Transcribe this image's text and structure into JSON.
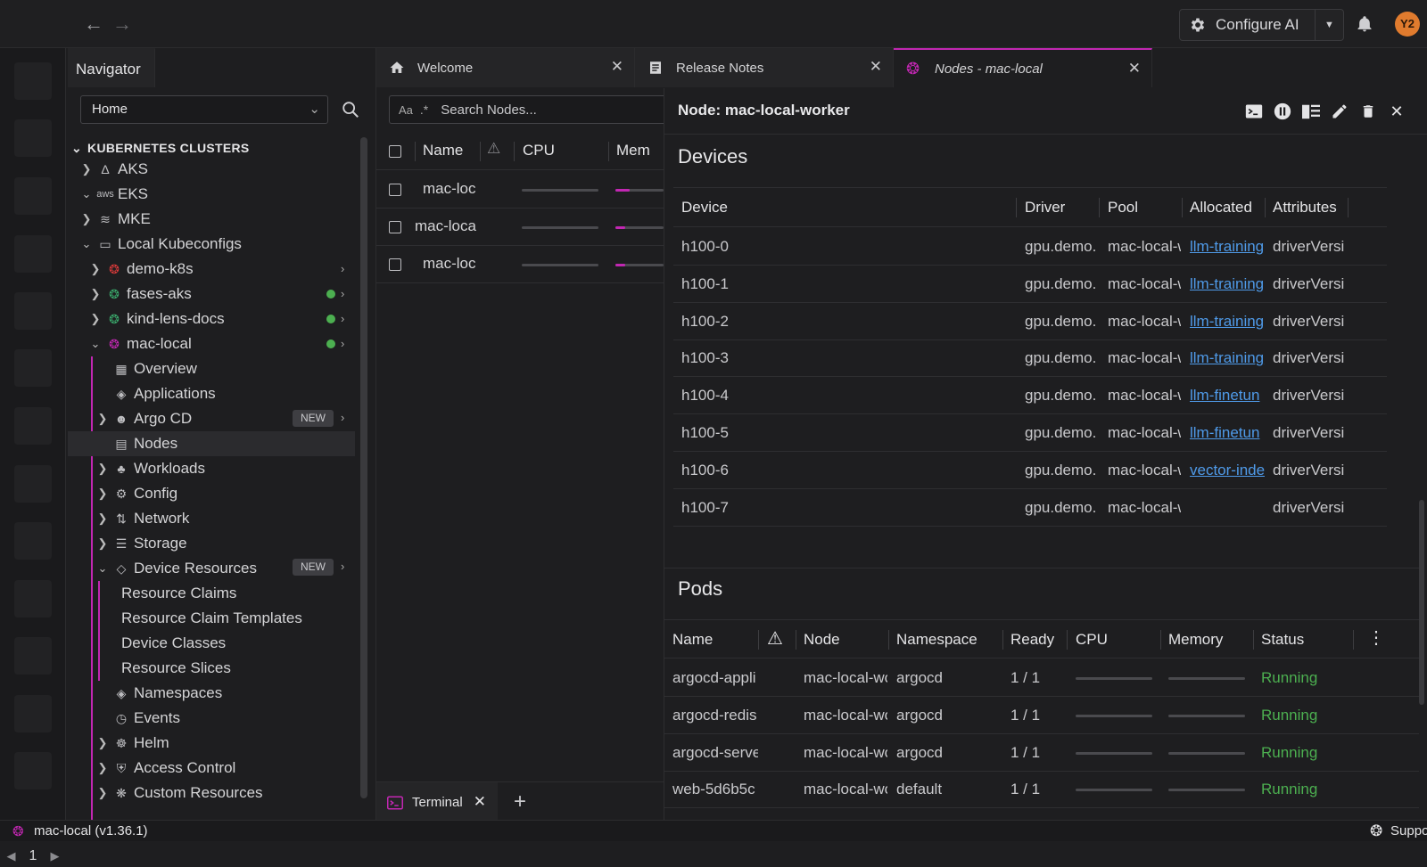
{
  "topbar": {
    "configure_label": "Configure AI",
    "avatar_initials": "Y2"
  },
  "rail": {
    "page": "1"
  },
  "navigator": {
    "tab_label": "Navigator",
    "location": "Home",
    "section_title": "KUBERNETES CLUSTERS",
    "providers": {
      "aks": "AKS",
      "eks": "EKS",
      "eks_logo": "aws",
      "mke": "MKE",
      "local": "Local Kubeconfigs"
    },
    "clusters": {
      "demo": "demo-k8s",
      "fases": "fases-aks",
      "kind": "kind-lens-docs",
      "mac": "mac-local"
    },
    "menu": {
      "overview": "Overview",
      "applications": "Applications",
      "argo": "Argo CD",
      "nodes": "Nodes",
      "workloads": "Workloads",
      "config": "Config",
      "network": "Network",
      "storage": "Storage",
      "device_resources": "Device Resources",
      "resource_claims": "Resource Claims",
      "resource_claim_templates": "Resource Claim Templates",
      "device_classes": "Device Classes",
      "resource_slices": "Resource Slices",
      "namespaces": "Namespaces",
      "events": "Events",
      "helm": "Helm",
      "access_control": "Access Control",
      "custom_resources": "Custom Resources"
    },
    "new_badge": "NEW",
    "colors": {
      "accent": "#c227b2",
      "connected": "#4caf50",
      "demo_icon": "#d83a3a",
      "aks_icon": "#3aa86b"
    }
  },
  "tabs": {
    "welcome": "Welcome",
    "release_notes": "Release Notes",
    "nodes": "Nodes - mac-local"
  },
  "nodes_list": {
    "search_case": "Aa",
    "search_regex": ".*",
    "search_placeholder": "Search Nodes...",
    "columns": {
      "name": "Name",
      "cpu": "CPU",
      "memory": "Mem"
    },
    "rows": [
      {
        "name": "mac-loc",
        "cpu": 0,
        "mem": 0.3
      },
      {
        "name": "mac-loca",
        "cpu": 0,
        "mem": 0.2
      },
      {
        "name": "mac-loc",
        "cpu": 0,
        "mem": 0.2
      }
    ]
  },
  "terminal": {
    "label": "Terminal"
  },
  "details": {
    "title": "Node: mac-local-worker",
    "devices": {
      "heading": "Devices",
      "columns": {
        "device": "Device",
        "driver": "Driver",
        "pool": "Pool",
        "allocated": "Allocated",
        "attributes": "Attributes"
      },
      "rows": [
        {
          "device": "h100-0",
          "driver": "gpu.demo.",
          "pool": "mac-local-w",
          "allocated": "llm-training",
          "attributes": "driverVersi"
        },
        {
          "device": "h100-1",
          "driver": "gpu.demo.",
          "pool": "mac-local-w",
          "allocated": "llm-training",
          "attributes": "driverVersi"
        },
        {
          "device": "h100-2",
          "driver": "gpu.demo.",
          "pool": "mac-local-w",
          "allocated": "llm-training",
          "attributes": "driverVersi"
        },
        {
          "device": "h100-3",
          "driver": "gpu.demo.",
          "pool": "mac-local-w",
          "allocated": "llm-training",
          "attributes": "driverVersi"
        },
        {
          "device": "h100-4",
          "driver": "gpu.demo.",
          "pool": "mac-local-w",
          "allocated": "llm-finetun",
          "attributes": "driverVersi"
        },
        {
          "device": "h100-5",
          "driver": "gpu.demo.",
          "pool": "mac-local-w",
          "allocated": "llm-finetun",
          "attributes": "driverVersi"
        },
        {
          "device": "h100-6",
          "driver": "gpu.demo.",
          "pool": "mac-local-w",
          "allocated": "vector-inde",
          "attributes": "driverVersi"
        },
        {
          "device": "h100-7",
          "driver": "gpu.demo.",
          "pool": "mac-local-w",
          "allocated": "",
          "attributes": "driverVersi"
        }
      ]
    },
    "pods": {
      "heading": "Pods",
      "columns": {
        "name": "Name",
        "node": "Node",
        "namespace": "Namespace",
        "ready": "Ready",
        "cpu": "CPU",
        "memory": "Memory",
        "status": "Status"
      },
      "rows": [
        {
          "name": "argocd-appli",
          "node": "mac-local-wo",
          "namespace": "argocd",
          "ready": "1 / 1",
          "status": "Running"
        },
        {
          "name": "argocd-redis",
          "node": "mac-local-wo",
          "namespace": "argocd",
          "ready": "1 / 1",
          "status": "Running"
        },
        {
          "name": "argocd-serve",
          "node": "mac-local-wo",
          "namespace": "argocd",
          "ready": "1 / 1",
          "status": "Running"
        },
        {
          "name": "web-5d6b5c",
          "node": "mac-local-wo",
          "namespace": "default",
          "ready": "1 / 1",
          "status": "Running"
        }
      ]
    }
  },
  "statusbar": {
    "cluster": "mac-local (v1.36.1)",
    "support": "Support"
  }
}
